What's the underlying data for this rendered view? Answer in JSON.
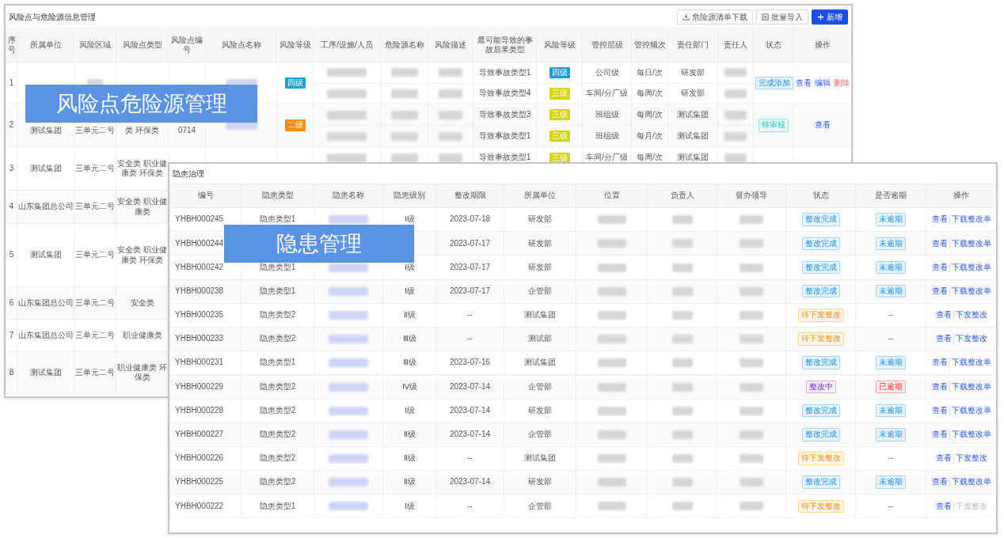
{
  "risk_panel": {
    "title": "风险点与危险源信息管理",
    "buttons": [
      {
        "label": "危险源清单下载",
        "kind": "download"
      },
      {
        "label": "批量导入",
        "kind": "import"
      },
      {
        "label": "新增",
        "kind": "add"
      }
    ],
    "columns": [
      "序号",
      "所属单位",
      "风险区域",
      "风险点类型",
      "风险点编号",
      "风险点名称",
      "风险等级",
      "工序/设施/人员",
      "危险源名称",
      "风险描述",
      "最可能导致的事故后果类型",
      "风险等级",
      "管控层级",
      "管控频次",
      "责任部门",
      "责任人",
      "状态",
      "操作"
    ],
    "rows": [
      {
        "no": "1",
        "area": {
          "kind": "blurred"
        },
        "name": {
          "kind": "blurred"
        },
        "level": {
          "text": "四级",
          "color": "#1e9fd8"
        },
        "subrows": [
          {
            "process": {
              "kind": "blurred"
            },
            "hazard": {
              "kind": "blurred"
            },
            "desc": {
              "kind": "blurred"
            },
            "consequence": "导致事故类型1",
            "level": {
              "text": "四级",
              "color": "#1e9fd8"
            },
            "control": "公司级",
            "freq": "每日/次",
            "dept": "研发部",
            "person": {
              "kind": "blurred"
            }
          },
          {
            "process": {
              "kind": "blurred"
            },
            "hazard": {
              "kind": "blurred"
            },
            "desc": {
              "kind": "blurred"
            },
            "consequence": "导致事故类型4",
            "level": {
              "text": "三级",
              "color": "#d6d60a"
            },
            "control": "车间/分厂级",
            "freq": "每周/次",
            "dept": "研发部",
            "person": {
              "kind": "blurred"
            }
          }
        ],
        "status": {
          "text": "完成添加",
          "kind": "info"
        },
        "actions": [
          {
            "label": "查看",
            "kind": "link"
          },
          {
            "label": "编辑",
            "kind": "link"
          },
          {
            "label": "删除",
            "kind": "danger"
          }
        ]
      },
      {
        "no": "2",
        "unit": "测试集团",
        "area": "三单元二号",
        "type": "类 环保类",
        "code": "0714",
        "name": {
          "kind": "blurred"
        },
        "level": {
          "text": "二级",
          "color": "#fa8c16"
        },
        "subrows": [
          {
            "process": {
              "kind": "blurred"
            },
            "hazard": {
              "kind": "blurred"
            },
            "desc": {
              "kind": "blurred"
            },
            "consequence": "导致事故类型3",
            "level": {
              "text": "三级",
              "color": "#d6d60a"
            },
            "control": "班组级",
            "freq": "每周/次",
            "dept": "测试集团",
            "person": {
              "kind": "blurred"
            }
          },
          {
            "process": {
              "kind": "blurred"
            },
            "hazard": {
              "kind": "blurred"
            },
            "desc": {
              "kind": "blurred"
            },
            "consequence": "导致事故类型1",
            "level": {
              "text": "三级",
              "color": "#d6d60a"
            },
            "control": "班组级",
            "freq": "每月/次",
            "dept": "测试集团",
            "person": {
              "kind": "blurred"
            }
          }
        ],
        "status": {
          "text": "待审核",
          "kind": "pending"
        },
        "actions": [
          {
            "label": "查看",
            "kind": "link"
          }
        ]
      },
      {
        "no": "3",
        "unit": "测试集团",
        "area": "三单元二号",
        "type": "安全类 职业健康类 环保类",
        "subrows": [
          {
            "process": {
              "kind": "blurred"
            },
            "hazard": {
              "kind": "blurred"
            },
            "desc": {
              "kind": "blurred"
            },
            "consequence": "导致事故类型1",
            "level": {
              "text": "三级",
              "color": "#d6d60a"
            },
            "control": "车间/分厂级",
            "freq": "每周/次",
            "dept": "测试集团",
            "person": {
              "kind": "blurred"
            }
          }
        ]
      },
      {
        "no": "4",
        "unit": "山东集团总公司",
        "area": "三单元二号",
        "type": "安全类 职业健康类"
      },
      {
        "no": "5",
        "unit": "测试集团",
        "area": "三单元二号",
        "type": "安全类 职业健康类 环保类"
      },
      {
        "no": "6",
        "unit": "山东集团总公司",
        "area": "三单元二号",
        "type": "安全类"
      },
      {
        "no": "7",
        "unit": "山东集团总公司",
        "area": "三单元二号",
        "type": "职业健康类"
      },
      {
        "no": "8",
        "unit": "测试集团",
        "area": "三单元二号",
        "type": "职业健康类 环保类"
      }
    ]
  },
  "hazard_panel": {
    "title": "隐患治理",
    "columns": [
      "编号",
      "隐患类型",
      "隐患名称",
      "隐患级别",
      "整改期限",
      "所属单位",
      "位置",
      "负责人",
      "督办领导",
      "状态",
      "是否逾期",
      "操作"
    ],
    "rows": [
      {
        "id": "YHBH000245",
        "type": "隐患类型1",
        "name": {
          "kind": "blurred"
        },
        "level": "Ⅰ级",
        "deadline": "2023-07-18",
        "unit": "研发部",
        "location": {
          "kind": "blurred"
        },
        "owner": {
          "kind": "blurred"
        },
        "supervisor": {
          "kind": "blurred"
        },
        "status": {
          "text": "整改完成",
          "kind": "info"
        },
        "overdue": {
          "text": "未逾期",
          "kind": "info"
        },
        "actions": [
          {
            "label": "查看",
            "kind": "link"
          },
          {
            "label": "下载整改单",
            "kind": "link"
          }
        ]
      },
      {
        "id": "YHBH000244",
        "unit": "研发部",
        "deadline": "2023-07-17",
        "location": {
          "kind": "blurred"
        },
        "owner": {
          "kind": "blurred"
        },
        "supervisor": {
          "kind": "blurred"
        },
        "status": {
          "text": "整改完成",
          "kind": "info"
        },
        "overdue": {
          "text": "未逾期",
          "kind": "info"
        },
        "actions": [
          {
            "label": "查看",
            "kind": "link"
          },
          {
            "label": "下载整改单",
            "kind": "link"
          }
        ]
      },
      {
        "id": "YHBH000242",
        "type": "隐患类型1",
        "name": {
          "kind": "blurred"
        },
        "level": "Ⅰ级",
        "deadline": "2023-07-17",
        "unit": "研发部",
        "location": {
          "kind": "blurred"
        },
        "owner": {
          "kind": "blurred"
        },
        "supervisor": {
          "kind": "blurred"
        },
        "status": {
          "text": "整改完成",
          "kind": "info"
        },
        "overdue": {
          "text": "未逾期",
          "kind": "info"
        },
        "actions": [
          {
            "label": "查看",
            "kind": "link"
          },
          {
            "label": "下载整改单",
            "kind": "link"
          }
        ]
      },
      {
        "id": "YHBH000238",
        "type": "隐患类型1",
        "name": {
          "kind": "blurred"
        },
        "level": "Ⅰ级",
        "deadline": "2023-07-17",
        "unit": "企管部",
        "location": {
          "kind": "blurred"
        },
        "owner": {
          "kind": "blurred"
        },
        "supervisor": {
          "kind": "blurred"
        },
        "status": {
          "text": "整改完成",
          "kind": "info"
        },
        "overdue": {
          "text": "未逾期",
          "kind": "info"
        },
        "actions": [
          {
            "label": "查看",
            "kind": "link"
          },
          {
            "label": "下载整改单",
            "kind": "link"
          }
        ]
      },
      {
        "id": "YHBH000235",
        "type": "隐患类型2",
        "name": {
          "kind": "blurred"
        },
        "level": "Ⅱ级",
        "deadline": "--",
        "unit": "测试集团",
        "location": {
          "kind": "blurred"
        },
        "owner": {
          "kind": "blurred"
        },
        "supervisor": {
          "kind": "blurred"
        },
        "status": {
          "text": "待下发整改",
          "kind": "todo"
        },
        "overdue": {
          "text": "--",
          "kind": "plain"
        },
        "actions": [
          {
            "label": "查看",
            "kind": "link"
          },
          {
            "label": "下发整改",
            "kind": "link"
          }
        ]
      },
      {
        "id": "YHBH000233",
        "type": "隐患类型2",
        "name": {
          "kind": "blurred"
        },
        "level": "Ⅲ级",
        "deadline": "--",
        "unit": "测试部",
        "location": {
          "kind": "blurred"
        },
        "owner": {
          "kind": "blurred"
        },
        "supervisor": {
          "kind": "blurred"
        },
        "status": {
          "text": "待下发整改",
          "kind": "todo"
        },
        "overdue": {
          "text": "--",
          "kind": "plain"
        },
        "actions": [
          {
            "label": "查看",
            "kind": "link"
          },
          {
            "label": "下发整改",
            "kind": "link"
          }
        ]
      },
      {
        "id": "YHBH000231",
        "type": "隐患类型1",
        "name": {
          "kind": "blurred"
        },
        "level": "Ⅲ级",
        "deadline": "2023-07-16",
        "unit": "测试集团",
        "location": {
          "kind": "blurred"
        },
        "owner": {
          "kind": "blurred"
        },
        "supervisor": {
          "kind": "blurred"
        },
        "status": {
          "text": "整改完成",
          "kind": "info"
        },
        "overdue": {
          "text": "未逾期",
          "kind": "info"
        },
        "actions": [
          {
            "label": "查看",
            "kind": "link"
          },
          {
            "label": "下载整改单",
            "kind": "link"
          }
        ]
      },
      {
        "id": "YHBH000229",
        "type": "隐患类型2",
        "name": {
          "kind": "blurred"
        },
        "level": "Ⅳ级",
        "deadline": "2023-07-14",
        "unit": "企管部",
        "location": {
          "kind": "blurred"
        },
        "owner": {
          "kind": "blurred"
        },
        "supervisor": {
          "kind": "blurred"
        },
        "status": {
          "text": "整改中",
          "kind": "doing"
        },
        "overdue": {
          "text": "已逾期",
          "kind": "danger"
        },
        "actions": [
          {
            "label": "查看",
            "kind": "link"
          },
          {
            "label": "下载整改单",
            "kind": "link"
          }
        ]
      },
      {
        "id": "YHBH000228",
        "type": "隐患类型2",
        "name": {
          "kind": "blurred"
        },
        "level": "Ⅰ级",
        "deadline": "2023-07-14",
        "unit": "研发部",
        "location": {
          "kind": "blurred"
        },
        "owner": {
          "kind": "blurred"
        },
        "supervisor": {
          "kind": "blurred"
        },
        "status": {
          "text": "整改完成",
          "kind": "info"
        },
        "overdue": {
          "text": "未逾期",
          "kind": "info"
        },
        "actions": [
          {
            "label": "查看",
            "kind": "link"
          },
          {
            "label": "下载整改单",
            "kind": "link"
          }
        ]
      },
      {
        "id": "YHBH000227",
        "type": "隐患类型2",
        "name": {
          "kind": "blurred"
        },
        "level": "Ⅱ级",
        "deadline": "2023-07-14",
        "unit": "企管部",
        "location": {
          "kind": "blurred"
        },
        "owner": {
          "kind": "blurred"
        },
        "supervisor": {
          "kind": "blurred"
        },
        "status": {
          "text": "整改完成",
          "kind": "info"
        },
        "overdue": {
          "text": "未逾期",
          "kind": "info"
        },
        "actions": [
          {
            "label": "查看",
            "kind": "link"
          },
          {
            "label": "下载整改单",
            "kind": "link"
          }
        ]
      },
      {
        "id": "YHBH000226",
        "type": "隐患类型2",
        "name": {
          "kind": "blurred"
        },
        "level": "Ⅱ级",
        "deadline": "--",
        "unit": "测试集团",
        "location": {
          "kind": "blurred"
        },
        "owner": {
          "kind": "blurred"
        },
        "supervisor": {
          "kind": "blurred"
        },
        "status": {
          "text": "待下发整改",
          "kind": "todo"
        },
        "overdue": {
          "text": "--",
          "kind": "plain"
        },
        "actions": [
          {
            "label": "查看",
            "kind": "link"
          },
          {
            "label": "下发整改",
            "kind": "link"
          }
        ]
      },
      {
        "id": "YHBH000225",
        "type": "隐患类型2",
        "name": {
          "kind": "blurred"
        },
        "level": "Ⅱ级",
        "deadline": "2023-07-14",
        "unit": "研发部",
        "location": {
          "kind": "blurred"
        },
        "owner": {
          "kind": "blurred"
        },
        "supervisor": {
          "kind": "blurred"
        },
        "status": {
          "text": "整改完成",
          "kind": "info"
        },
        "overdue": {
          "text": "未逾期",
          "kind": "info"
        },
        "actions": [
          {
            "label": "查看",
            "kind": "link"
          },
          {
            "label": "下载整改单",
            "kind": "link"
          }
        ]
      },
      {
        "id": "YHBH000222",
        "type": "隐患类型1",
        "name": {
          "kind": "blurred"
        },
        "level": "Ⅰ级",
        "deadline": "--",
        "unit": "企管部",
        "location": {
          "kind": "blurred"
        },
        "owner": {
          "kind": "blurred"
        },
        "supervisor": {
          "kind": "blurred"
        },
        "status": {
          "text": "待下发整改",
          "kind": "todo"
        },
        "overdue": {
          "text": "--",
          "kind": "plain"
        },
        "actions": [
          {
            "label": "查看",
            "kind": "link"
          },
          {
            "label": "下发整改",
            "kind": "disabled"
          }
        ]
      }
    ]
  },
  "overlay_labels": [
    "风险点危险源管理",
    "隐患管理"
  ]
}
